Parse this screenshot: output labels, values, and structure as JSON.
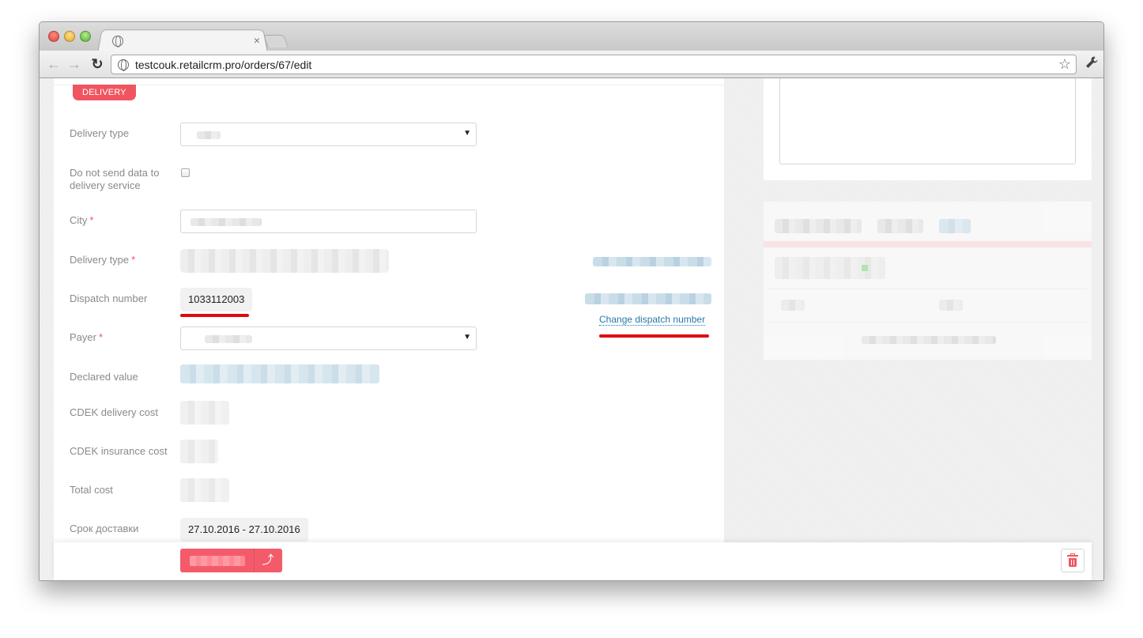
{
  "browser": {
    "tab_close": "×",
    "url": "testcouk.retailcrm.pro/orders/67/edit",
    "nav": {
      "back": "←",
      "forward": "→",
      "reload": "↻"
    },
    "star": "☆",
    "wrench": "🔧"
  },
  "delivery": {
    "badge": "DELIVERY",
    "labels": {
      "delivery_type": "Delivery type",
      "do_not_send": "Do not send data to delivery service",
      "city": "City",
      "delivery_type_2": "Delivery type",
      "dispatch_number": "Dispatch number",
      "payer": "Payer",
      "declared_value": "Declared value",
      "cdek_delivery_cost": "CDEK delivery cost",
      "cdek_insurance_cost": "CDEK insurance cost",
      "total_cost": "Total cost",
      "delivery_term": "Срок доставки"
    },
    "required_mark": "*",
    "select_caret": "▼",
    "dispatch_number_value": "1033112003",
    "change_dispatch_link": "Change dispatch number",
    "delivery_term_value": "27.10.2016 - 27.10.2016"
  },
  "actions": {
    "upload_icon": "⤴"
  },
  "colors": {
    "accent_red": "#f0555f",
    "link_blue": "#2579a8",
    "highlight_underline": "#e1080f"
  },
  "icons": [
    "globe-icon",
    "close-icon",
    "star-icon",
    "wrench-icon",
    "upload-icon",
    "trash-icon"
  ]
}
